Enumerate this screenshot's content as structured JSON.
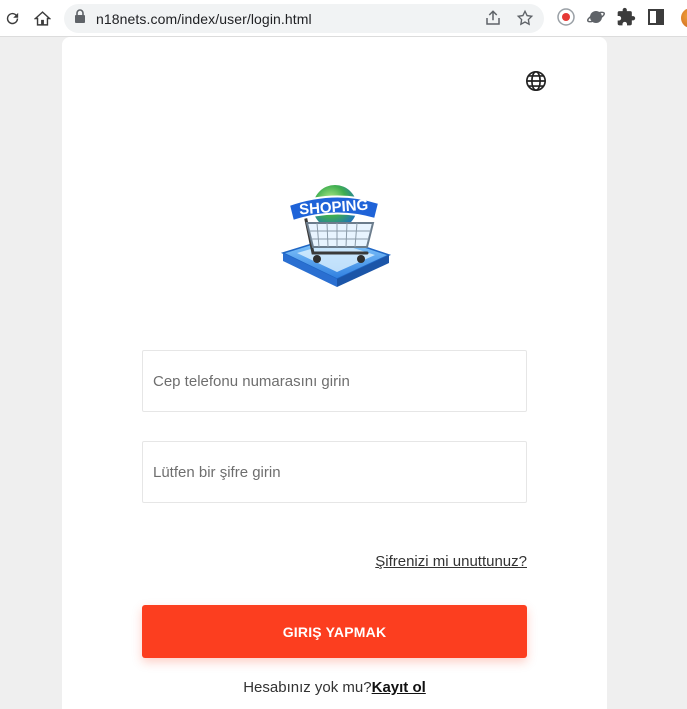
{
  "browser": {
    "url": "n18nets.com/index/user/login.html"
  },
  "logo": {
    "text": "SHOPING"
  },
  "form": {
    "phone_placeholder": "Cep telefonu numarasını girin",
    "password_placeholder": "Lütfen bir şifre girin",
    "forgot_label": "Şifrenizi mi unuttunuz?",
    "login_label": "GIRIŞ YAPMAK",
    "no_account_text": "Hesabınız yok mu?",
    "register_label": "Kayıt ol"
  },
  "colors": {
    "primary": "#fc3e1f",
    "page_bg": "#efefef"
  }
}
